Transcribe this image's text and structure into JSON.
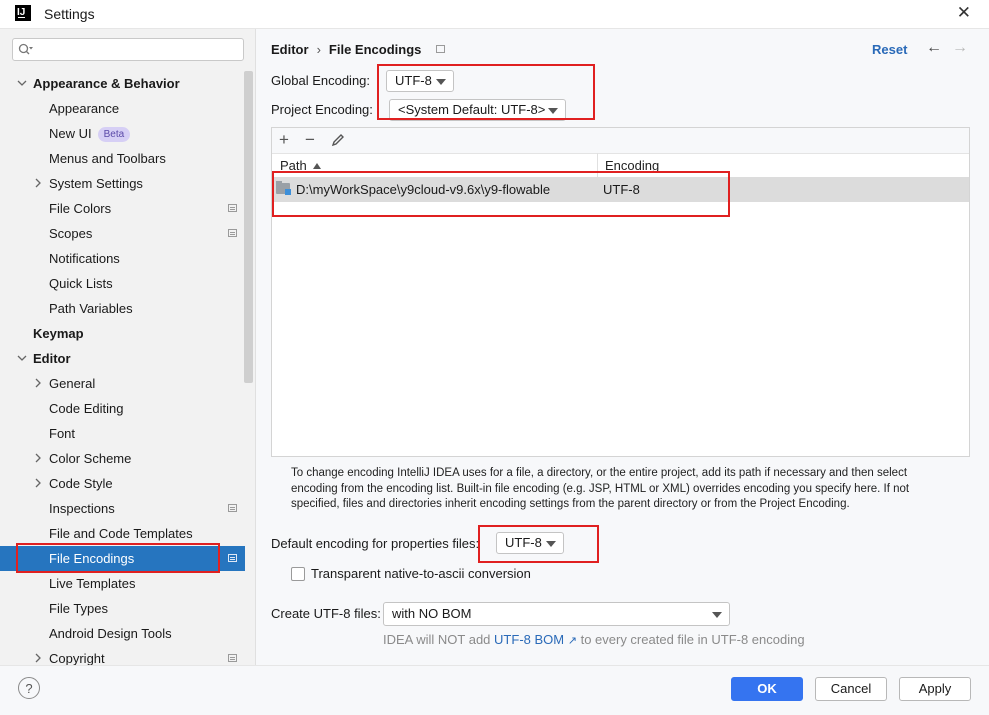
{
  "window": {
    "title": "Settings"
  },
  "search": {
    "placeholder": ""
  },
  "sidebar": {
    "items": [
      {
        "label": "Appearance & Behavior"
      },
      {
        "label": "Appearance"
      },
      {
        "label": "New UI",
        "badge": "Beta"
      },
      {
        "label": "Menus and Toolbars"
      },
      {
        "label": "System Settings"
      },
      {
        "label": "File Colors"
      },
      {
        "label": "Scopes"
      },
      {
        "label": "Notifications"
      },
      {
        "label": "Quick Lists"
      },
      {
        "label": "Path Variables"
      },
      {
        "label": "Keymap"
      },
      {
        "label": "Editor"
      },
      {
        "label": "General"
      },
      {
        "label": "Code Editing"
      },
      {
        "label": "Font"
      },
      {
        "label": "Color Scheme"
      },
      {
        "label": "Code Style"
      },
      {
        "label": "Inspections"
      },
      {
        "label": "File and Code Templates"
      },
      {
        "label": "File Encodings"
      },
      {
        "label": "Live Templates"
      },
      {
        "label": "File Types"
      },
      {
        "label": "Android Design Tools"
      },
      {
        "label": "Copyright"
      }
    ]
  },
  "breadcrumb": {
    "parent": "Editor",
    "separator": "›",
    "current": "File Encodings"
  },
  "header": {
    "reset_label": "Reset",
    "back_icon": "←",
    "forward_icon": "→"
  },
  "encodings": {
    "global_label": "Global Encoding:",
    "global_value": "UTF-8",
    "project_label": "Project Encoding:",
    "project_value": "<System Default: UTF-8>"
  },
  "table": {
    "toolbar": {
      "add": "+",
      "remove": "−"
    },
    "columns": [
      "Path",
      "Encoding"
    ],
    "rows": [
      {
        "path": "D:\\myWorkSpace\\y9cloud-v9.6x\\y9-flowable",
        "encoding": "UTF-8"
      }
    ]
  },
  "description": "To change encoding IntelliJ IDEA uses for a file, a directory, or the entire project, add its path if necessary and then select encoding from the encoding list. Built-in file encoding (e.g. JSP, HTML or XML) overrides encoding you specify here. If not specified, files and directories inherit encoding settings from the parent directory or from the Project Encoding.",
  "properties": {
    "label": "Default encoding for properties files:",
    "value": "UTF-8",
    "transparent_label": "Transparent native-to-ascii conversion"
  },
  "utf8": {
    "label": "Create UTF-8 files:",
    "value": "with NO BOM",
    "hint_prefix": "IDEA will NOT add",
    "hint_link": "UTF-8 BOM",
    "hint_suffix": "to every created file in UTF-8 encoding"
  },
  "buttons": {
    "help": "?",
    "ok": "OK",
    "cancel": "Cancel",
    "apply": "Apply"
  },
  "colors": {
    "accent": "#3574f0",
    "selection": "#2675bf",
    "annotation": "#e02020",
    "link": "#2a6ab8"
  }
}
